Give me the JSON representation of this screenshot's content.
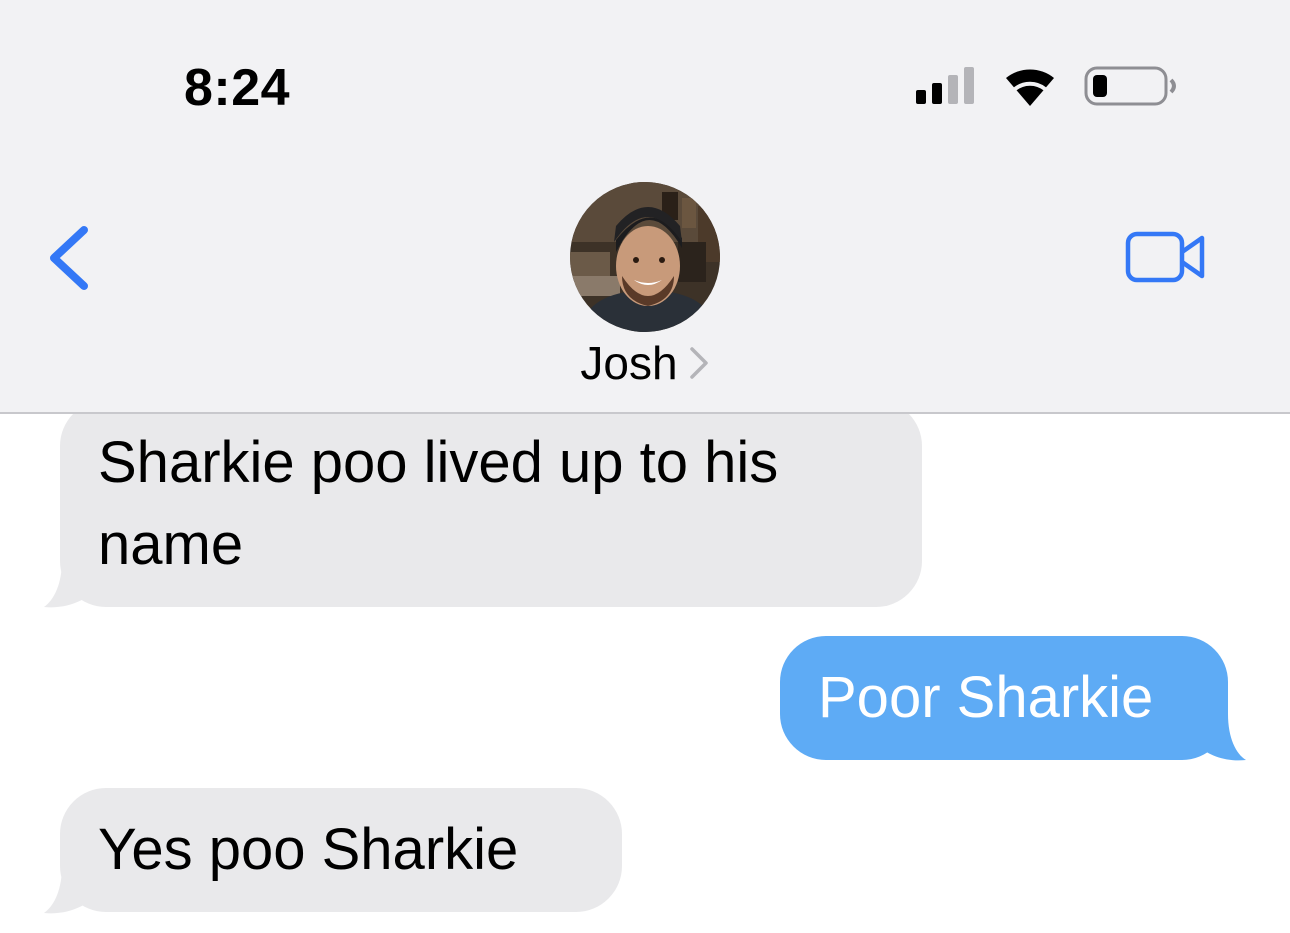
{
  "status_bar": {
    "time": "8:24",
    "icons": [
      "cellular-signal-icon",
      "wifi-icon",
      "battery-icon"
    ]
  },
  "nav": {
    "back_icon": "chevron-left-icon",
    "video_icon": "video-camera-icon",
    "contact_name": "Josh",
    "contact_chevron_icon": "chevron-right-icon"
  },
  "messages": [
    {
      "direction": "incoming",
      "text": "Sharkie poo lived up to his name"
    },
    {
      "direction": "outgoing",
      "text": "Poor Sharkie"
    },
    {
      "direction": "incoming",
      "text": "Yes poo Sharkie"
    }
  ],
  "colors": {
    "accent": "#3478f6",
    "outgoing_bubble": "#5eabf5",
    "incoming_bubble": "#e9e9eb",
    "header_background": "#f2f2f4"
  }
}
